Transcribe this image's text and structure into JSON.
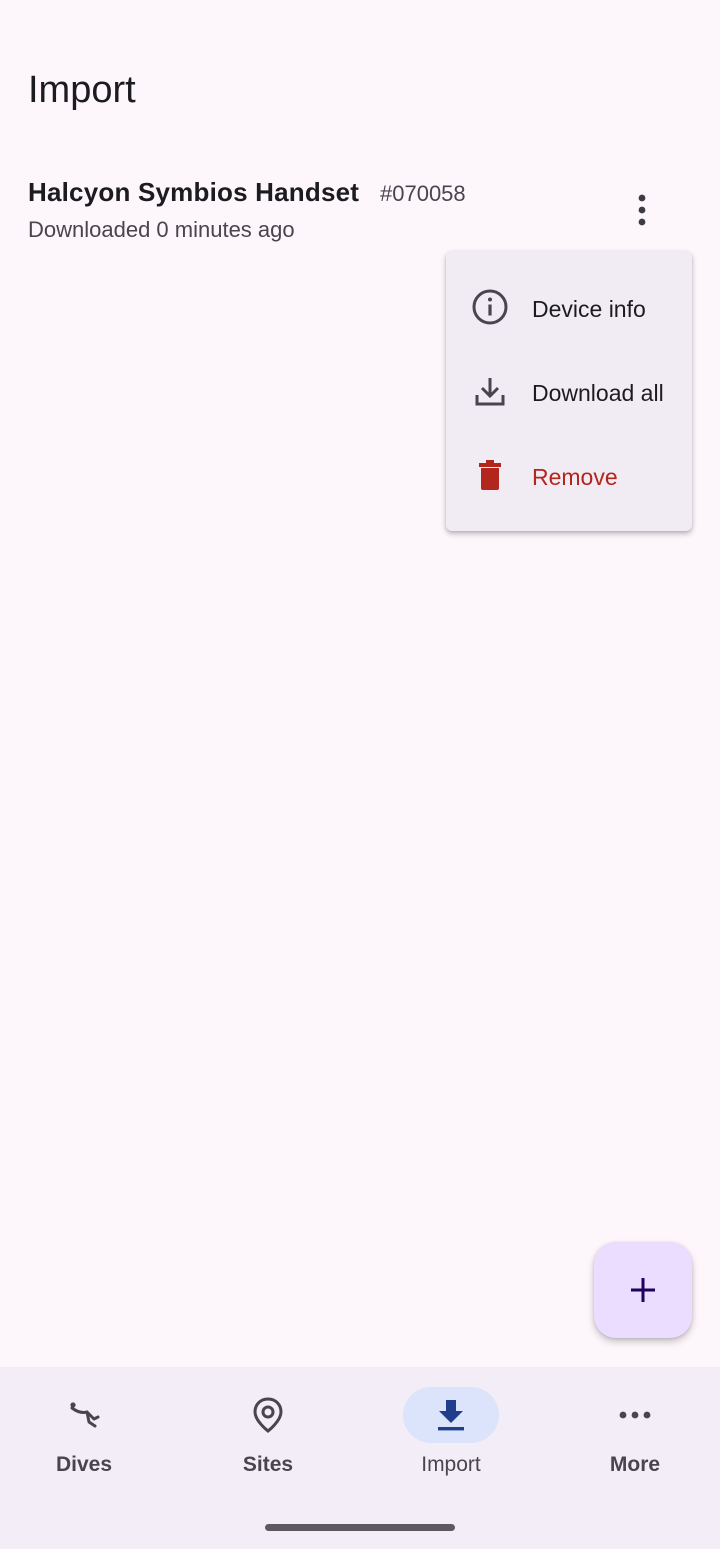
{
  "page": {
    "title": "Import"
  },
  "device": {
    "name": "Halcyon Symbios Handset",
    "serial": "#070058",
    "status": "Downloaded 0 minutes ago",
    "menu_icon": "more-vert-icon"
  },
  "menu": {
    "items": [
      {
        "label": "Device info",
        "icon": "info-icon"
      },
      {
        "label": "Download all",
        "icon": "download-icon"
      },
      {
        "label": "Remove",
        "icon": "trash-icon",
        "color": "#b3261e"
      }
    ]
  },
  "fab": {
    "icon": "plus-icon",
    "color": "#eaddff"
  },
  "nav": {
    "items": [
      {
        "label": "Dives",
        "icon": "diver-icon",
        "active": false
      },
      {
        "label": "Sites",
        "icon": "location-pin-icon",
        "active": false
      },
      {
        "label": "Import",
        "icon": "download-icon",
        "active": true
      },
      {
        "label": "More",
        "icon": "more-horiz-icon",
        "active": false
      }
    ],
    "active_color": "#dce4fb",
    "active_icon_color": "#1f3e8c"
  }
}
